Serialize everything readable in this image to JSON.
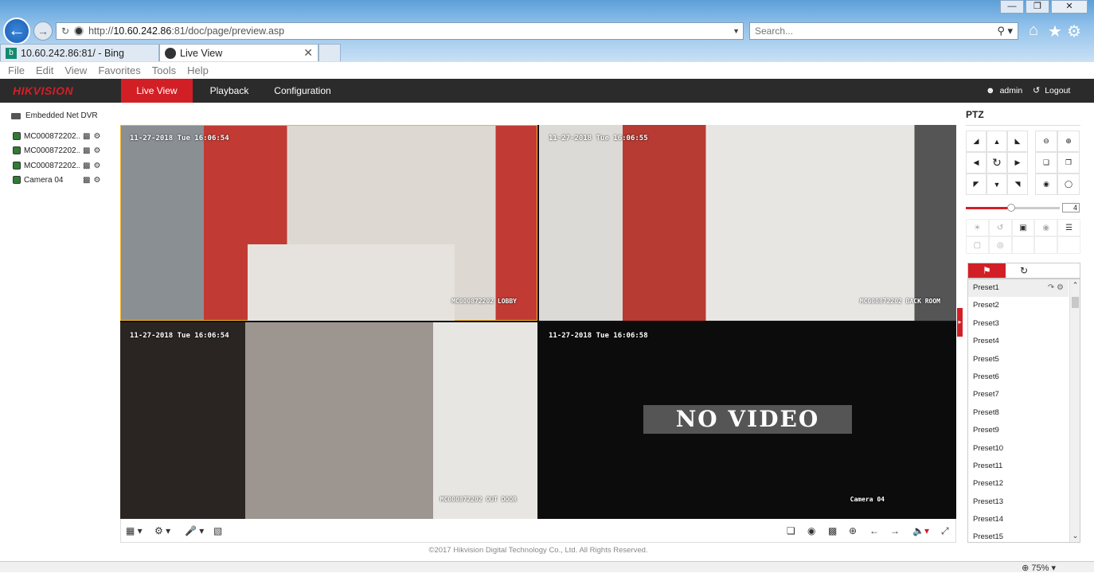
{
  "browser": {
    "url_prefix": "http://",
    "url_host": "10.60.242.86",
    "url_rest": ":81/doc/page/preview.asp",
    "search_placeholder": "Search...",
    "tabs": [
      {
        "label": "10.60.242.86:81/ - Bing"
      },
      {
        "label": "Live View"
      }
    ],
    "menu": [
      "File",
      "Edit",
      "View",
      "Favorites",
      "Tools",
      "Help"
    ],
    "window_buttons": [
      "—",
      "❐",
      "✕"
    ]
  },
  "app": {
    "logo": "HIKVISION",
    "nav": [
      {
        "label": "Live View",
        "active": true
      },
      {
        "label": "Playback"
      },
      {
        "label": "Configuration"
      }
    ],
    "user": "admin",
    "logout": "Logout"
  },
  "tree": {
    "root": "Embedded Net DVR",
    "cameras": [
      "MC000872202...",
      "MC000872202...",
      "MC000872202...",
      "Camera 04"
    ]
  },
  "grid": {
    "tiles": [
      {
        "time": "11-27-2018 Tue 16:06:54",
        "name": "MC000872202 LOBBY",
        "selected": true
      },
      {
        "time": "11-27-2018 Tue 16:06:55",
        "name": "MC000872202 BACK ROOM"
      },
      {
        "time": "11-27-2018 Tue 16:06:54",
        "name": "MC000872202 OUT DOOR"
      },
      {
        "time": "11-27-2018 Tue 16:06:58",
        "name": "Camera 04",
        "no_video": "NO VIDEO"
      }
    ]
  },
  "footer": "©2017 Hikvision Digital Technology Co., Ltd. All Rights Reserved.",
  "ptz": {
    "title": "PTZ",
    "speed": "4",
    "speed_fraction": 0.48,
    "presets": [
      "Preset1",
      "Preset2",
      "Preset3",
      "Preset4",
      "Preset5",
      "Preset6",
      "Preset7",
      "Preset8",
      "Preset9",
      "Preset10",
      "Preset11",
      "Preset12",
      "Preset13",
      "Preset14",
      "Preset15"
    ]
  },
  "status": {
    "zoom": "75%"
  },
  "colors": {
    "accent": "#d21f26",
    "header": "#2b2b2b",
    "selected_border": "#f2b124"
  }
}
